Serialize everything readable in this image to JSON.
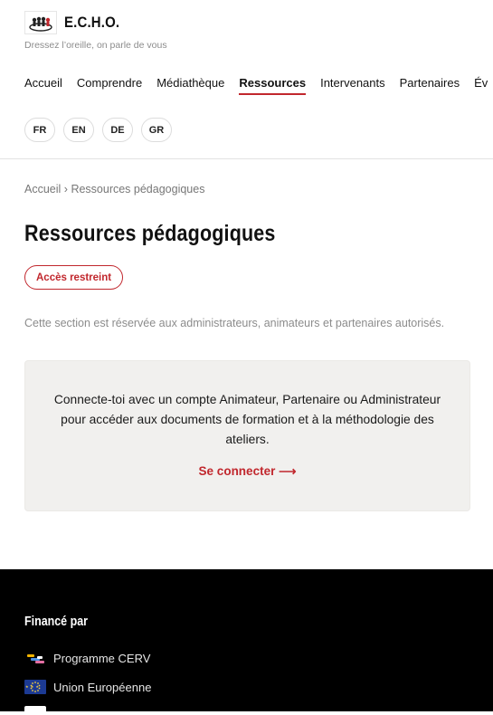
{
  "site": {
    "title": "E.C.H.O.",
    "tagline": "Dressez l’oreille, on parle de vous",
    "logo_icon": "people-circle-logo"
  },
  "nav": {
    "items": [
      {
        "label": "Accueil",
        "active": false
      },
      {
        "label": "Comprendre",
        "active": false
      },
      {
        "label": "Médiathèque",
        "active": false
      },
      {
        "label": "Ressources",
        "active": true
      },
      {
        "label": "Intervenants",
        "active": false
      },
      {
        "label": "Partenaires",
        "active": false
      },
      {
        "label": "Év",
        "active": false
      }
    ]
  },
  "languages": [
    "FR",
    "EN",
    "DE",
    "GR"
  ],
  "breadcrumb": {
    "home": "Accueil",
    "separator": "›",
    "current": "Ressources pédagogiques"
  },
  "page": {
    "title": "Ressources pédagogiques",
    "badge": "Accès restreint",
    "description": "Cette section est réservée aux administrateurs, animateurs et partenaires autorisés."
  },
  "card": {
    "message": "Connecte-toi avec un compte Animateur, Partenaire ou Administrateur pour accéder aux documents de formation et à la méthodologie des ateliers.",
    "link_label": "Se connecter ⟶"
  },
  "footer": {
    "title": "Financé par",
    "funders": [
      {
        "label": "Programme CERV",
        "icon": "cerv-logo-icon"
      },
      {
        "label": "Union Européenne",
        "icon": "eu-flag-icon"
      }
    ]
  },
  "colors": {
    "accent": "#c1272d",
    "footer_bg": "#000000",
    "card_bg": "#f1f0ee"
  }
}
